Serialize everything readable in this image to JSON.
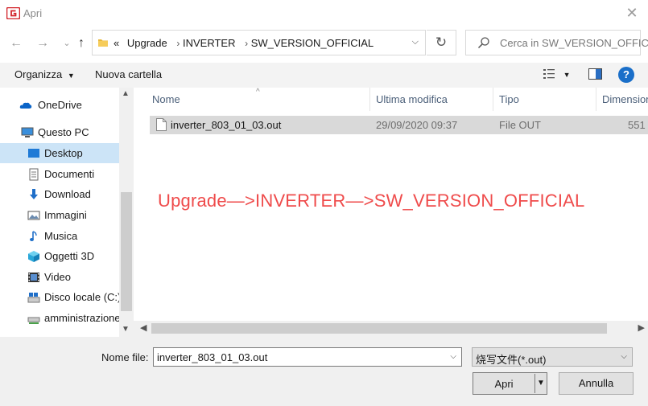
{
  "window": {
    "title": "Apri"
  },
  "address": {
    "overflow": "«",
    "crumbs": [
      "Upgrade",
      "INVERTER",
      "SW_VERSION_OFFICIAL"
    ]
  },
  "search": {
    "placeholder": "Cerca in SW_VERSION_OFFIC..."
  },
  "toolbar": {
    "organize": "Organizza",
    "new_folder": "Nuova cartella"
  },
  "nav": {
    "items": [
      {
        "label": "OneDrive",
        "icon": "cloud-icon"
      },
      {
        "label": "Questo PC",
        "icon": "computer-icon"
      },
      {
        "label": "Desktop",
        "icon": "desktop-icon",
        "selected": true
      },
      {
        "label": "Documenti",
        "icon": "document-icon"
      },
      {
        "label": "Download",
        "icon": "download-icon"
      },
      {
        "label": "Immagini",
        "icon": "pictures-icon"
      },
      {
        "label": "Musica",
        "icon": "music-icon"
      },
      {
        "label": "Oggetti 3D",
        "icon": "cube-icon"
      },
      {
        "label": "Video",
        "icon": "video-icon"
      },
      {
        "label": "Disco locale (C:)",
        "icon": "drive-icon"
      },
      {
        "label": "amministrazione",
        "icon": "network-drive-icon"
      }
    ]
  },
  "columns": [
    "Nome",
    "Ultima modifica",
    "Tipo",
    "Dimensione"
  ],
  "files": [
    {
      "name": "inverter_803_01_03.out",
      "modified": "29/09/2020 09:37",
      "type": "File OUT",
      "size": "551"
    }
  ],
  "annotation": "Upgrade—>INVERTER—>SW_VERSION_OFFICIAL",
  "footer": {
    "filename_label": "Nome file:",
    "filename_value": "inverter_803_01_03.out",
    "filter_value": "烧写文件(*.out)",
    "open_label": "Apri",
    "cancel_label": "Annulla"
  },
  "colors": {
    "selected_bg": "#cce4f7",
    "annotation": "#ef4b4b",
    "help": "#1a6fc9"
  }
}
